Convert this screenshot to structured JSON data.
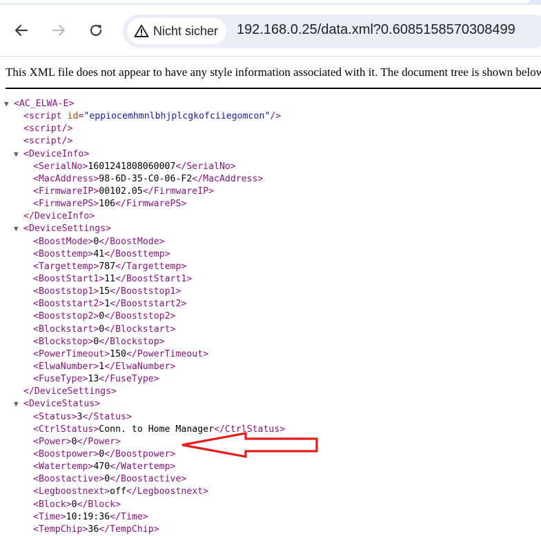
{
  "browser": {
    "security_label": "Nicht sicher",
    "url": "192.168.0.25/data.xml?0.6085158570308499"
  },
  "notice": "This XML file does not appear to have any style information associated with it. The document tree is shown below.",
  "tree": {
    "root_open": "<AC_ELWA-E>",
    "script1": {
      "open_start": "<script",
      "attr_name": "id",
      "eq": "=",
      "attr_value": "\"eppiocemhmnlbhjplcgkofciiegomcon\"",
      "close": "/>"
    },
    "script2": "<script/>",
    "script3": "<script/>",
    "device_info": {
      "open": "<DeviceInfo>",
      "close": "</DeviceInfo>",
      "items": [
        {
          "open": "<SerialNo>",
          "value": "1601241808060007",
          "close": "</SerialNo>"
        },
        {
          "open": "<MacAddress>",
          "value": "98-6D-35-C0-06-F2",
          "close": "</MacAddress>"
        },
        {
          "open": "<FirmwareIP>",
          "value": "00102.05",
          "close": "</FirmwareIP>"
        },
        {
          "open": "<FirmwarePS>",
          "value": "106",
          "close": "</FirmwarePS>"
        }
      ]
    },
    "device_settings": {
      "open": "<DeviceSettings>",
      "close": "</DeviceSettings>",
      "items": [
        {
          "open": "<BoostMode>",
          "value": "0",
          "close": "</BoostMode>"
        },
        {
          "open": "<Boosttemp>",
          "value": "41",
          "close": "</Boosttemp>"
        },
        {
          "open": "<Targettemp>",
          "value": "787",
          "close": "</Targettemp>"
        },
        {
          "open": "<BoostStart1>",
          "value": "11",
          "close": "</BoostStart1>"
        },
        {
          "open": "<Booststop1>",
          "value": "15",
          "close": "</Booststop1>"
        },
        {
          "open": "<Booststart2>",
          "value": "1",
          "close": "</Booststart2>"
        },
        {
          "open": "<Booststop2>",
          "value": "0",
          "close": "</Booststop2>"
        },
        {
          "open": "<Blockstart>",
          "value": "0",
          "close": "</Blockstart>"
        },
        {
          "open": "<Blockstop>",
          "value": "0",
          "close": "</Blockstop>"
        },
        {
          "open": "<PowerTimeout>",
          "value": "150",
          "close": "</PowerTimeout>"
        },
        {
          "open": "<ElwaNumber>",
          "value": "1",
          "close": "</ElwaNumber>"
        },
        {
          "open": "<FuseType>",
          "value": "13",
          "close": "</FuseType>"
        }
      ]
    },
    "device_status": {
      "open": "<DeviceStatus>",
      "items": [
        {
          "open": "<Status>",
          "value": "3",
          "close": "</Status>"
        },
        {
          "open": "<CtrlStatus>",
          "value": "Conn. to Home Manager",
          "close": "</CtrlStatus>"
        },
        {
          "open": "<Power>",
          "value": "0",
          "close": "</Power>"
        },
        {
          "open": "<Boostpower>",
          "value": "0",
          "close": "</Boostpower>"
        },
        {
          "open": "<Watertemp>",
          "value": "470",
          "close": "</Watertemp>"
        },
        {
          "open": "<Boostactive>",
          "value": "0",
          "close": "</Boostactive>"
        },
        {
          "open": "<Legboostnext>",
          "value": "off",
          "close": "</Legboostnext>"
        },
        {
          "open": "<Block>",
          "value": "0",
          "close": "</Block>"
        },
        {
          "open": "<Time>",
          "value": "10:19:36",
          "close": "</Time>"
        },
        {
          "open": "<TempChip>",
          "value": "36",
          "close": "</TempChip>"
        }
      ]
    }
  },
  "colors": {
    "tag": "#881280",
    "attribute_name": "#994500",
    "attribute_value": "#1a1aa6",
    "annotation_arrow": "#e31c1c"
  },
  "icons": {
    "back": "arrow-left-icon",
    "forward": "arrow-right-icon",
    "reload": "reload-icon",
    "security": "warning-triangle-icon",
    "collapse": "triangle-down-icon",
    "annotation": "red-arrow-icon"
  }
}
